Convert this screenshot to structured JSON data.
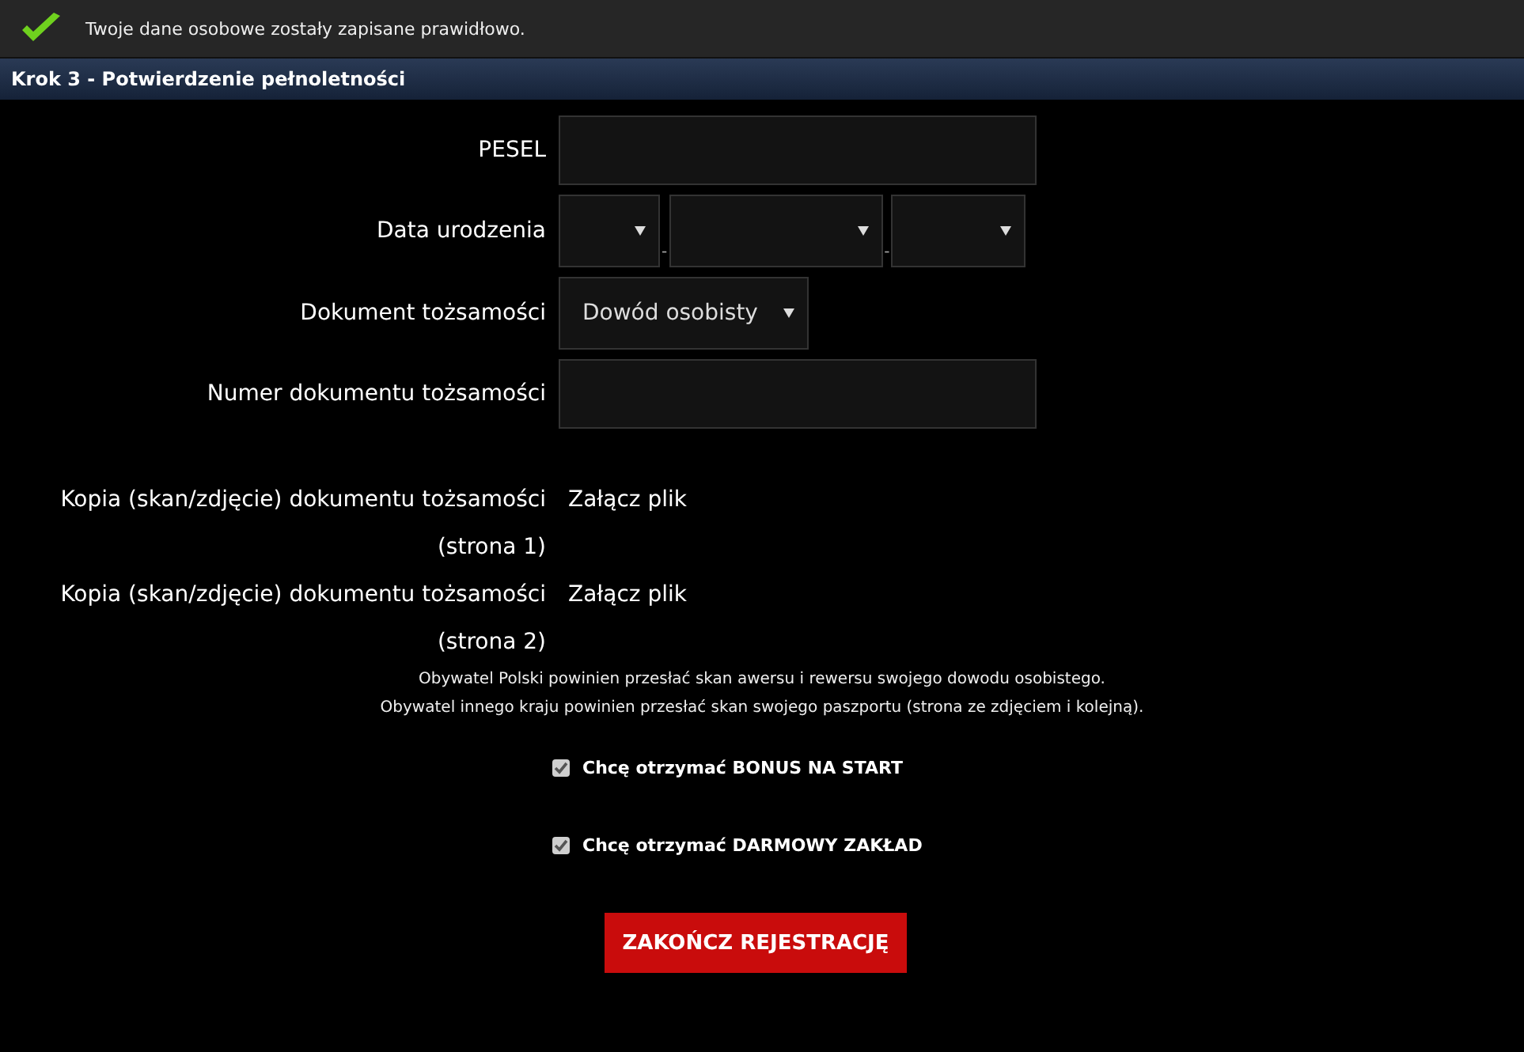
{
  "notice": {
    "text": "Twoje dane osobowe zostały zapisane prawidłowo."
  },
  "section": {
    "title": "Krok 3 - Potwierdzenie pełnoletności"
  },
  "fields": [
    {
      "kind": "text",
      "label": "PESEL"
    },
    {
      "kind": "date",
      "label": "Data urodzenia",
      "separators": [
        "-",
        "-"
      ]
    },
    {
      "kind": "select",
      "label": "Dokument tożsamości",
      "value": "Dowód osobisty"
    },
    {
      "kind": "text",
      "label": "Numer dokumentu tożsamości"
    }
  ],
  "uploads": [
    {
      "label": "Kopia (skan/zdjęcie) dokumentu tożsamości",
      "sublabel": "(strona 1)",
      "link": "Załącz plik"
    },
    {
      "label": "Kopia (skan/zdjęcie) dokumentu tożsamości",
      "sublabel": "(strona 2)",
      "link": "Załącz plik"
    }
  ],
  "notes": [
    "Obywatel Polski powinien przesłać skan awersu i rewersu swojego dowodu osobistego.",
    "Obywatel innego kraju powinien przesłać skan swojego paszportu (strona ze zdjęciem i kolejną)."
  ],
  "checkboxes": [
    {
      "label": "Chcę otrzymać BONUS NA START",
      "checked": true
    },
    {
      "label": "Chcę otrzymać DARMOWY ZAKŁAD",
      "checked": true
    }
  ],
  "submit": "ZAKOŃCZ REJESTRACJĘ"
}
